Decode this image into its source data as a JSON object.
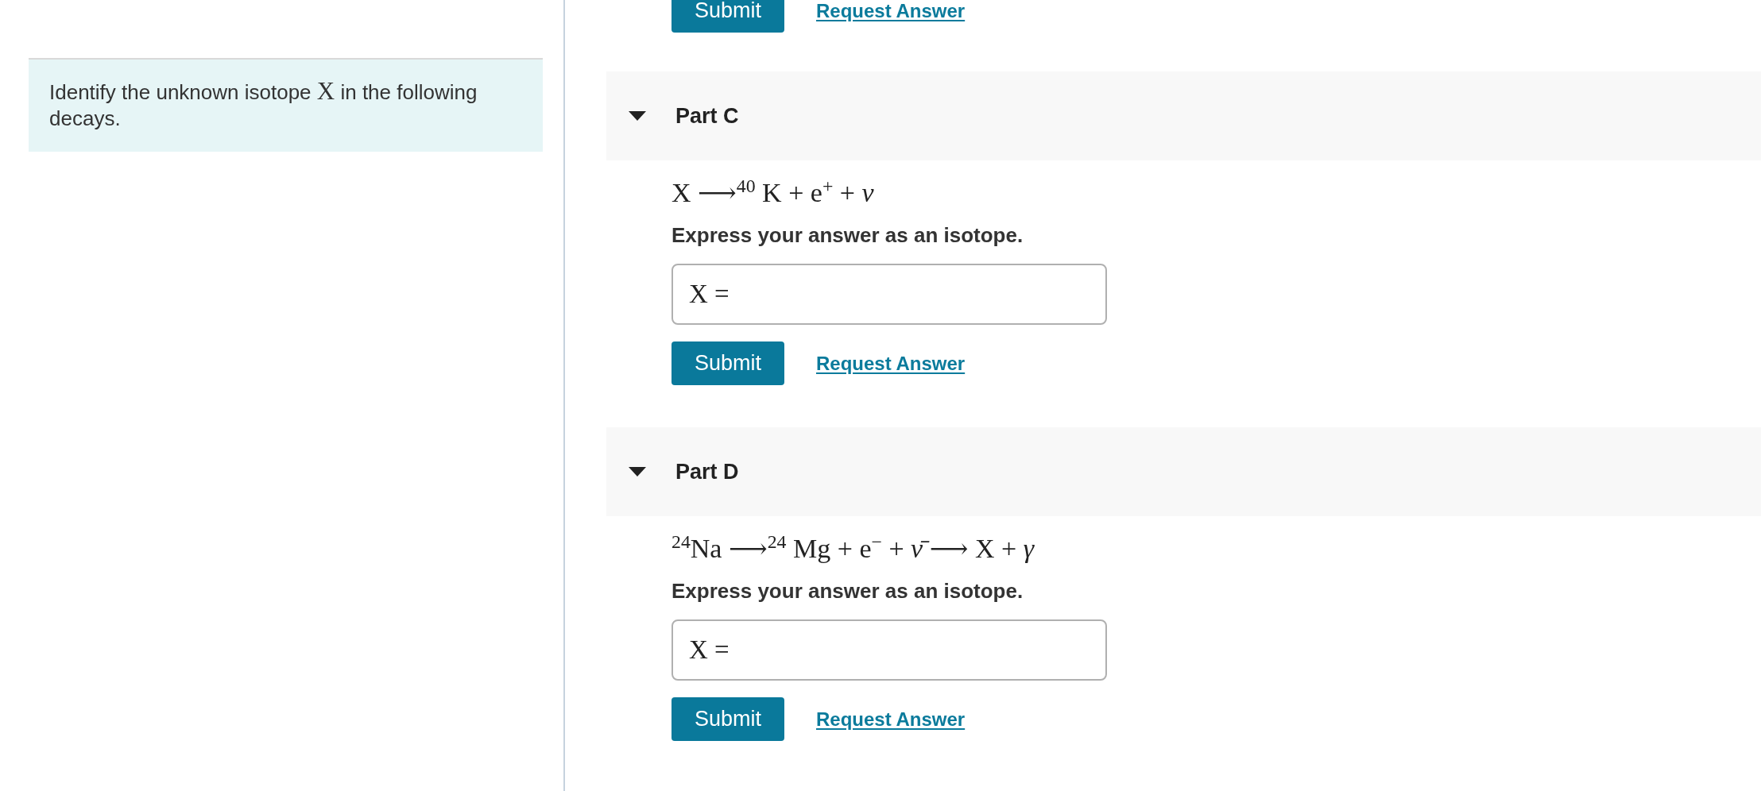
{
  "intro": {
    "segments": [
      {
        "kind": "text",
        "text": "Identify the unknown isotope"
      },
      {
        "kind": "math",
        "text": "X"
      },
      {
        "kind": "text",
        "text": "in the following decays."
      }
    ]
  },
  "previous_part": {
    "submit": "Submit",
    "request": "Request Answer"
  },
  "parts": [
    {
      "title": "Part C",
      "expanded": true,
      "equation": "X ⟶$^{40}$ K + e$^{+}$ + *ν*",
      "instruction": "Express your answer as an isotope.",
      "answer_label": "X =",
      "submit": "Submit",
      "request": "Request Answer"
    },
    {
      "title": "Part D",
      "expanded": true,
      "equation": "$^{24}$Na ⟶$^{24}$ Mg + e$^{−}$ + *ν̄* ⟶ X + *γ*",
      "instruction": "Express your answer as an isotope.",
      "answer_label": "X =",
      "submit": "Submit",
      "request": "Request Answer"
    }
  ]
}
